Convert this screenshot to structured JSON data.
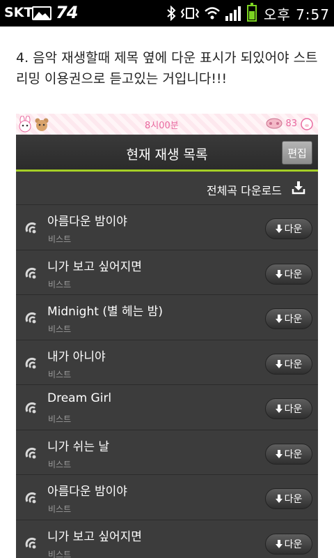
{
  "status_bar": {
    "carrier": "SKT",
    "badge_number": "74",
    "time": "오후 7:57",
    "icons": [
      "image-icon",
      "bluetooth-icon",
      "vibrate-icon",
      "wifi-icon",
      "signal-icon",
      "battery-icon"
    ]
  },
  "article": {
    "text": "4. 음악 재생할때 제목 옆에 다운 표시가 되있어야 스트리밍 이용권으로 듣고있는 거입니다!!!"
  },
  "banner": {
    "center_text": "8시00분",
    "right_text": "83"
  },
  "playlist": {
    "title": "현재 재생 목록",
    "edit_label": "편집",
    "download_all_label": "전체곡 다운로드",
    "download_button_label": "다운",
    "accent_color": "#a5cf26",
    "songs": [
      {
        "title": "아름다운 밤이야",
        "artist": "비스트"
      },
      {
        "title": "니가 보고 싶어지면",
        "artist": "비스트"
      },
      {
        "title": "Midnight (별 헤는 밤)",
        "artist": "비스트"
      },
      {
        "title": "내가 아니야",
        "artist": "비스트"
      },
      {
        "title": "Dream Girl",
        "artist": "비스트"
      },
      {
        "title": "니가 쉬는 날",
        "artist": "비스트"
      },
      {
        "title": "아름다운 밤이야",
        "artist": "비스트"
      },
      {
        "title": "니가 보고 싶어지면",
        "artist": "비스트"
      }
    ]
  }
}
